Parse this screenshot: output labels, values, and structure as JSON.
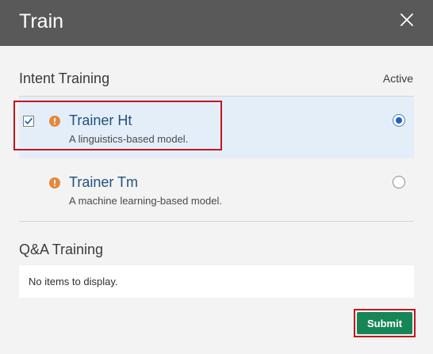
{
  "dialog": {
    "title": "Train",
    "close_icon": "close-icon"
  },
  "intent_training": {
    "heading": "Intent Training",
    "active_label": "Active",
    "trainers": [
      {
        "name": "Trainer Ht",
        "description": "A linguistics-based model.",
        "checked": true,
        "active": true,
        "status_icon": "warning-icon"
      },
      {
        "name": "Trainer Tm",
        "description": "A machine learning-based model.",
        "checked": false,
        "active": false,
        "status_icon": "warning-icon"
      }
    ]
  },
  "qa_training": {
    "heading": "Q&A Training",
    "empty_message": "No items to display."
  },
  "footer": {
    "submit_label": "Submit"
  },
  "colors": {
    "header_bg": "#595959",
    "selected_row_bg": "#e4eef9",
    "link_text": "#23517f",
    "warning": "#e5883b",
    "submit_bg": "#178657",
    "highlight_border": "#c0181d"
  }
}
